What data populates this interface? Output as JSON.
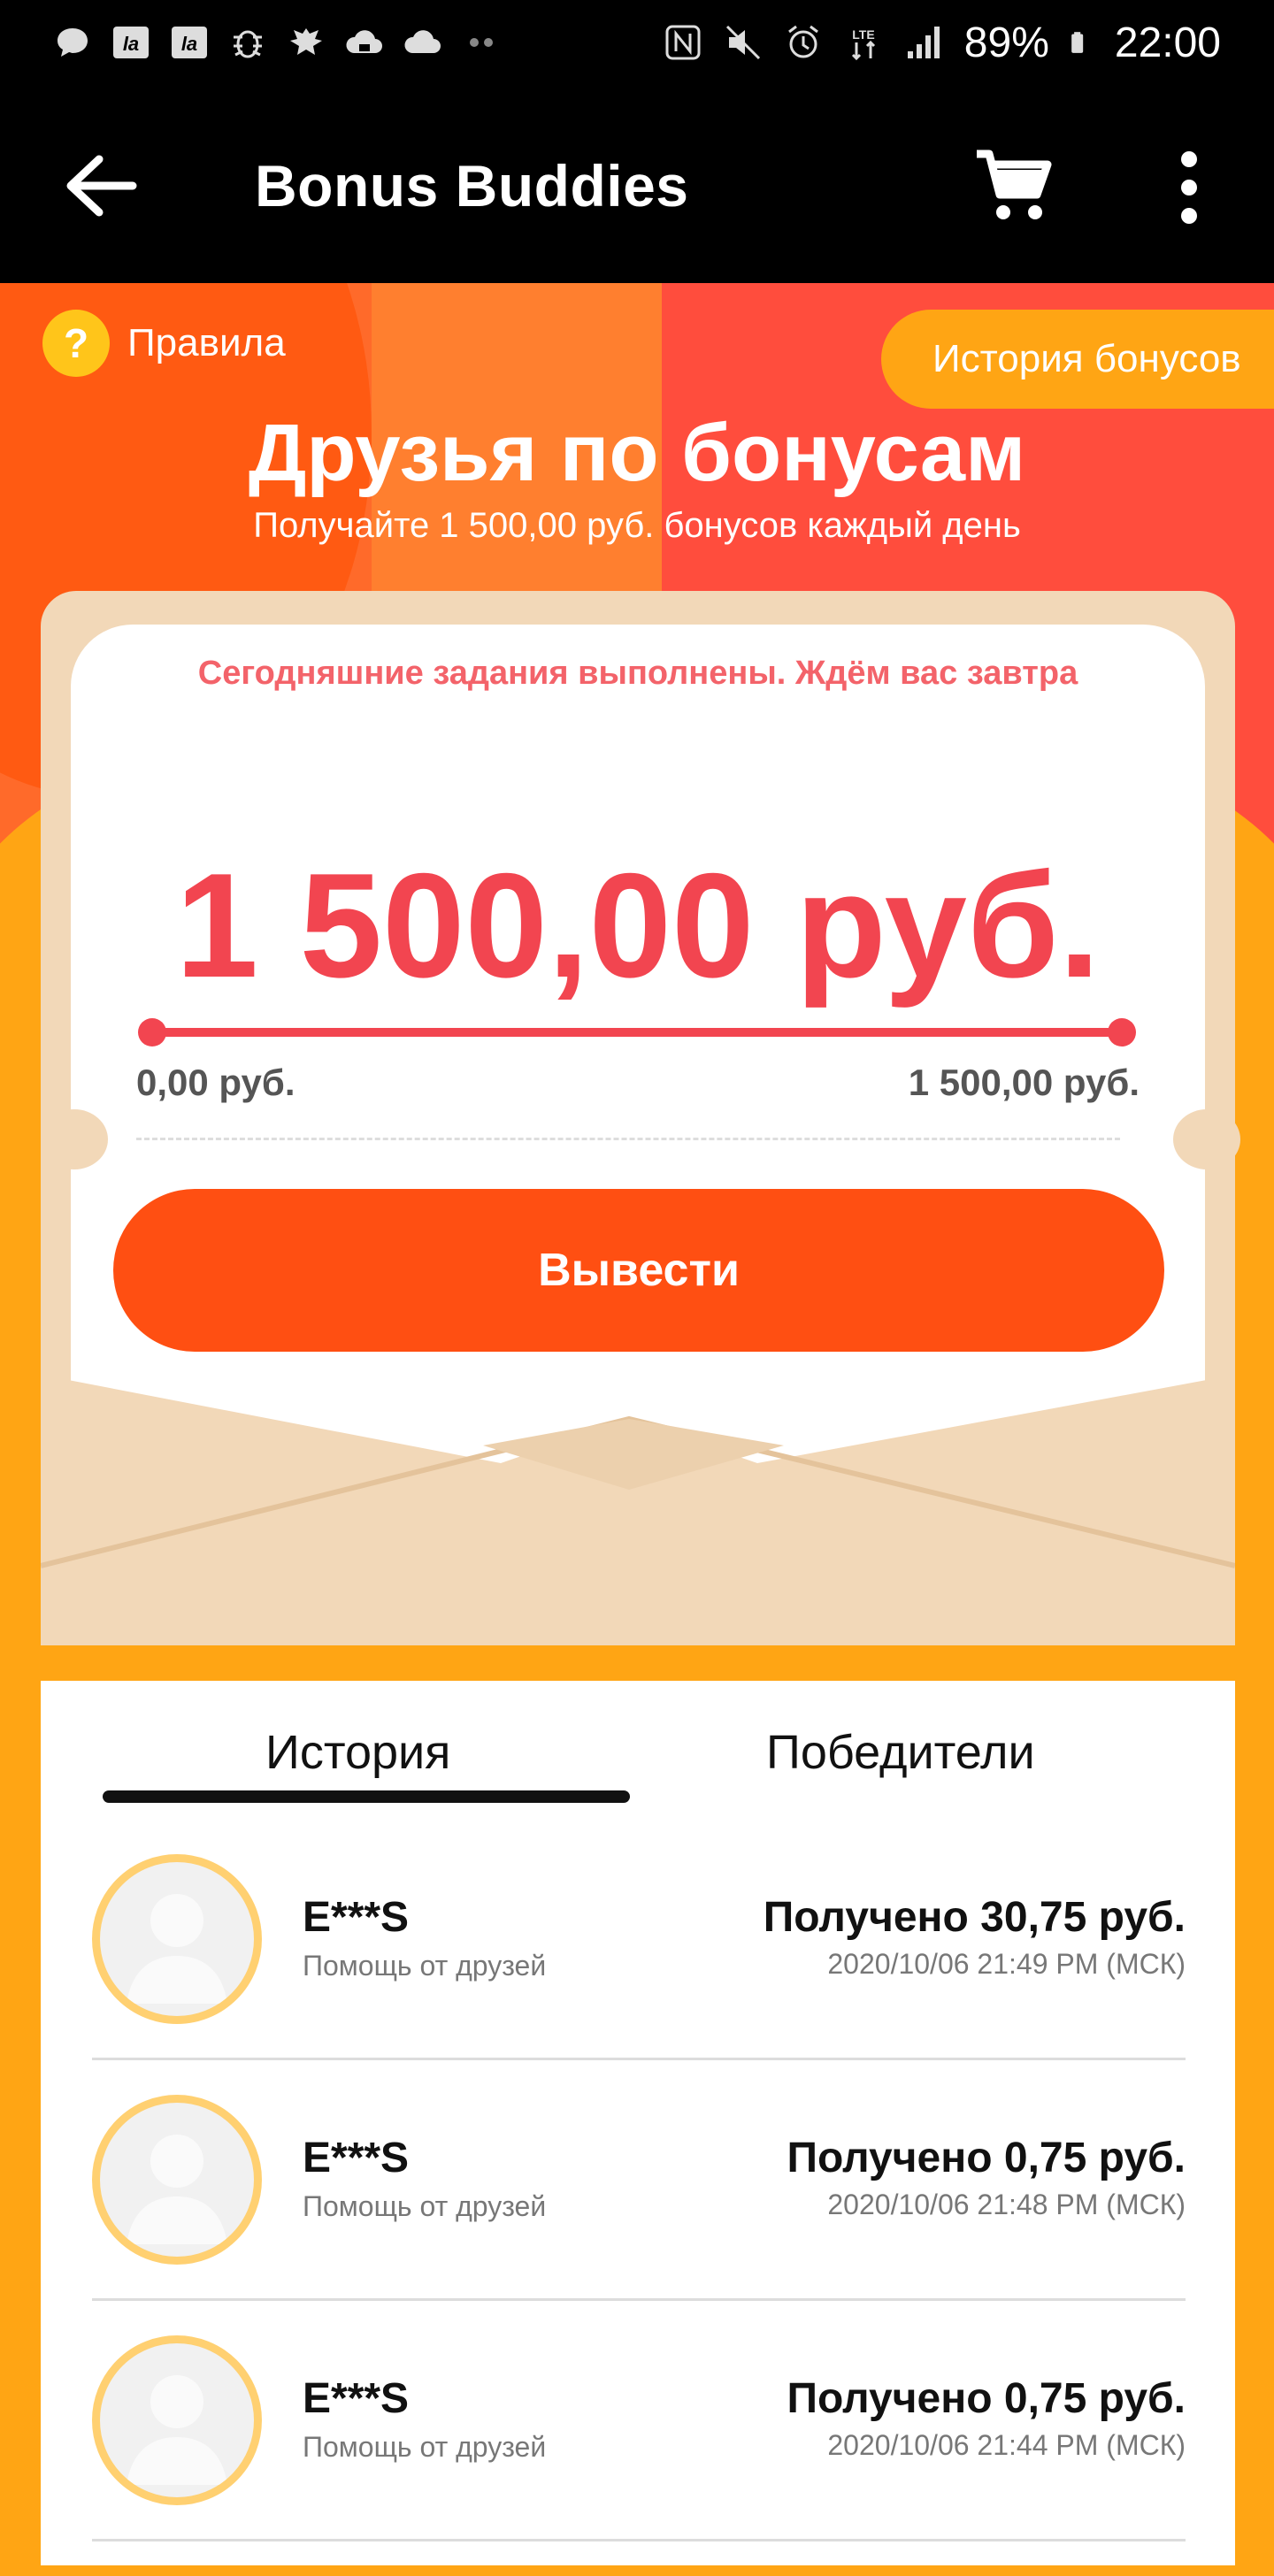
{
  "status_bar": {
    "battery": "89%",
    "time": "22:00",
    "left_icons": [
      "chat-icon",
      "la-icon",
      "la-icon",
      "bug-icon",
      "eagle-icon",
      "cloud-game-icon",
      "cloud-icon",
      "more-dots-icon"
    ],
    "right_icons": [
      "nfc-icon",
      "mute-icon",
      "alarm-icon",
      "lte-icon",
      "signal-icon",
      "battery-icon"
    ]
  },
  "appbar": {
    "title": "Bonus Buddies",
    "back_icon": "arrow-left-icon",
    "cart_icon": "cart-icon",
    "more_icon": "more-vertical-icon"
  },
  "hero": {
    "rules_label": "Правила",
    "rules_icon": "question-icon",
    "history_bonus_label": "История бонусов",
    "title": "Друзья по бонусам",
    "subtitle": "Получайте 1 500,00 руб. бонусов каждый день"
  },
  "card": {
    "notice": "Сегодняшние задания выполнены. Ждём вас завтра",
    "amount": "1 500,00 руб.",
    "progress_min": "0,00 руб.",
    "progress_max": "1 500,00 руб.",
    "progress_fraction": 1.0,
    "withdraw_label": "Вывести"
  },
  "tabs": {
    "history": "История",
    "winners": "Победители",
    "active": "history"
  },
  "history": [
    {
      "name": "E***S",
      "note": "Помощь от друзей",
      "received": "Получено 30,75 руб.",
      "date": "2020/10/06 21:49 PM (МСК)"
    },
    {
      "name": "E***S",
      "note": "Помощь от друзей",
      "received": "Получено 0,75 руб.",
      "date": "2020/10/06 21:48 PM (МСК)"
    },
    {
      "name": "E***S",
      "note": "Помощь от друзей",
      "received": "Получено 0,75 руб.",
      "date": "2020/10/06 21:44 PM (МСК)"
    }
  ],
  "colors": {
    "accent_red": "#f24550",
    "button_orange": "#ff4f12",
    "background_orange": "#ffa514",
    "envelope": "#f2d8b8"
  }
}
